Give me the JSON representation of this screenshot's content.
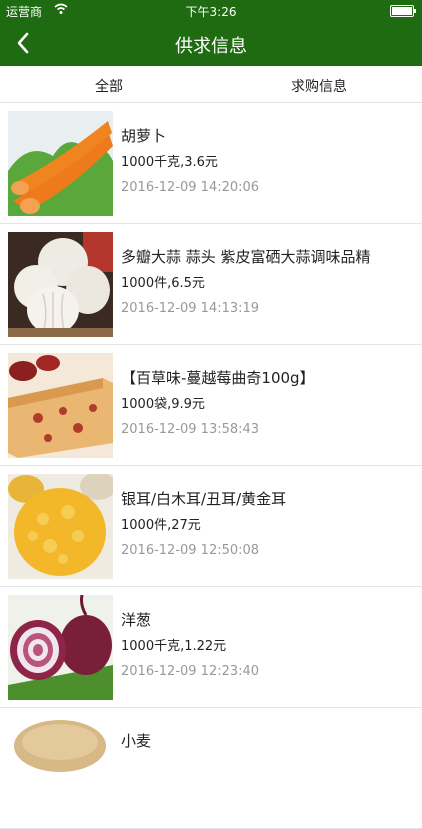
{
  "status": {
    "carrier": "运营商",
    "time": "下午3:26"
  },
  "nav": {
    "title": "供求信息"
  },
  "tabs": [
    "全部",
    "求购信息"
  ],
  "items": [
    {
      "title": "胡萝卜",
      "price": "1000千克,3.6元",
      "date": "2016-12-09 14:20:06",
      "image": "carrot"
    },
    {
      "title": "多瓣大蒜 蒜头 紫皮富硒大蒜调味品精",
      "price": "1000件,6.5元",
      "date": "2016-12-09 14:13:19",
      "image": "garlic"
    },
    {
      "title": "【百草味-蔓越莓曲奇100g】",
      "price": "1000袋,9.9元",
      "date": "2016-12-09 13:58:43",
      "image": "cookie"
    },
    {
      "title": "银耳/白木耳/丑耳/黄金耳",
      "price": "1000件,27元",
      "date": "2016-12-09 12:50:08",
      "image": "fungus"
    },
    {
      "title": "洋葱",
      "price": "1000千克,1.22元",
      "date": "2016-12-09 12:23:40",
      "image": "onion"
    },
    {
      "title": "小麦",
      "price": "",
      "date": "",
      "image": "wheat"
    }
  ]
}
